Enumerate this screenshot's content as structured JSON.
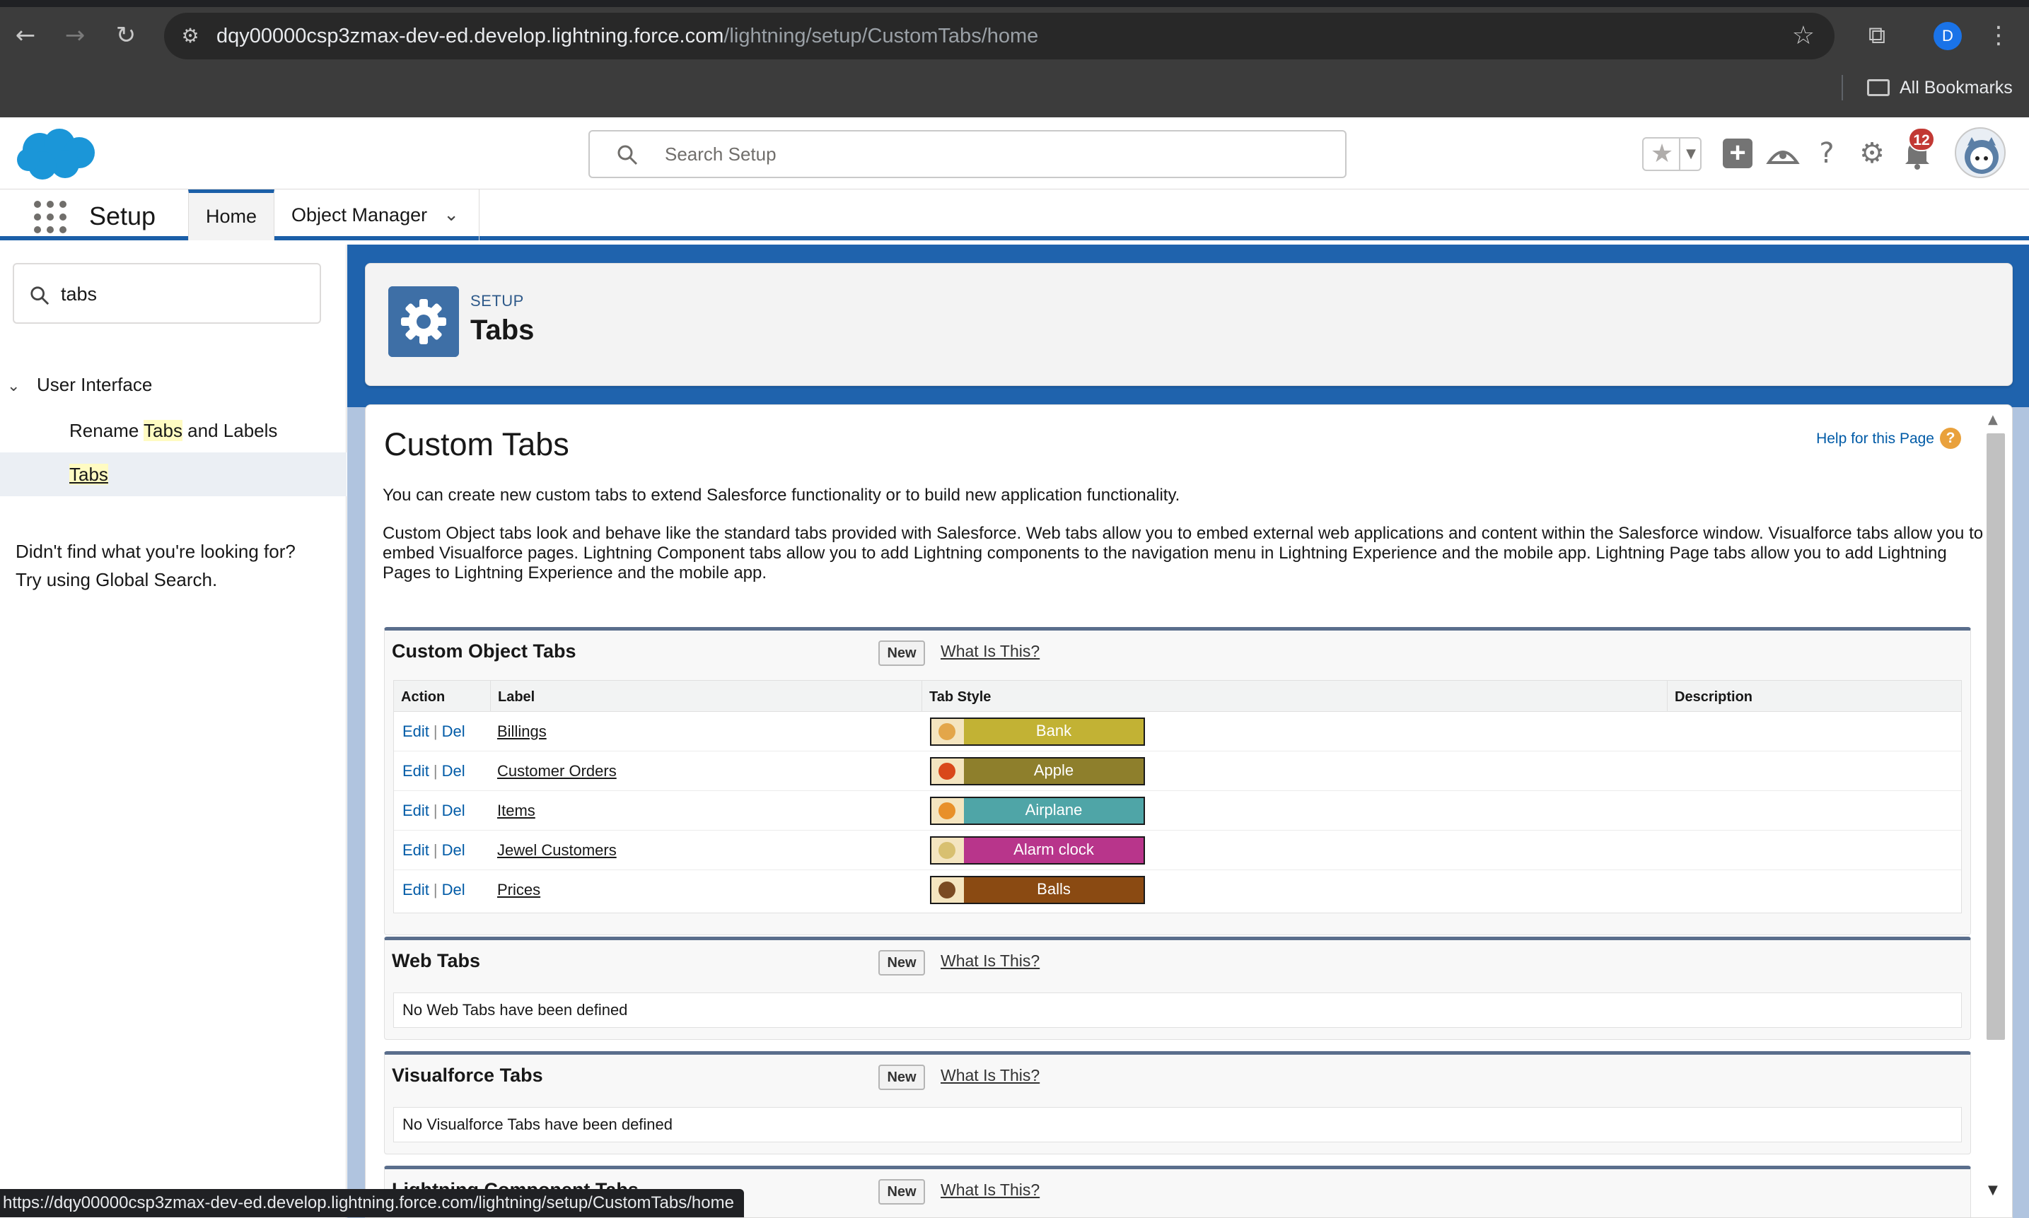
{
  "browser": {
    "url_host": "dqy00000csp3zmax-dev-ed.develop.lightning.force.com",
    "url_path": "/lightning/setup/CustomTabs/home",
    "profile_initial": "D",
    "bookmarks_label": "All Bookmarks",
    "status_url": "https://dqy00000csp3zmax-dev-ed.develop.lightning.force.com/lightning/setup/CustomTabs/home"
  },
  "header": {
    "search_placeholder": "Search Setup",
    "notification_count": "12"
  },
  "context_bar": {
    "app_name": "Setup",
    "tabs": [
      {
        "label": "Home"
      },
      {
        "label": "Object Manager"
      }
    ]
  },
  "sidebar": {
    "quick_find_value": "tabs",
    "group_label": "User Interface",
    "items": [
      {
        "pre": "Rename ",
        "match": "Tabs",
        "post": " and Labels"
      },
      {
        "pre": "",
        "match": "Tabs",
        "post": ""
      }
    ],
    "not_found_line1": "Didn't find what you're looking for?",
    "not_found_line2": "Try using Global Search."
  },
  "page_header": {
    "eyebrow": "SETUP",
    "title": "Tabs"
  },
  "content": {
    "title": "Custom Tabs",
    "help_link": "Help for this Page",
    "intro1": "You can create new custom tabs to extend Salesforce functionality or to build new application functionality.",
    "intro2": "Custom Object tabs look and behave like the standard tabs provided with Salesforce. Web tabs allow you to embed external web applications and content within the Salesforce window. Visualforce tabs allow you to embed Visualforce pages. Lightning Component tabs allow you to add Lightning components to the navigation menu in Lightning Experience and the mobile app. Lightning Page tabs allow you to add Lightning Pages to Lightning Experience and the mobile app.",
    "new_label": "New",
    "what_label": "What Is This?",
    "edit_label": "Edit",
    "del_label": "Del",
    "custom_object_tabs": {
      "title": "Custom Object Tabs",
      "columns": [
        "Action",
        "Label",
        "Tab Style",
        "Description"
      ],
      "rows": [
        {
          "label": "Billings",
          "style": "Bank",
          "color": "#c2b234",
          "icon_color": "#e3a64a"
        },
        {
          "label": "Customer Orders",
          "style": "Apple",
          "color": "#8e7f2c",
          "icon_color": "#d9481a"
        },
        {
          "label": "Items",
          "style": "Airplane",
          "color": "#4fa5a7",
          "icon_color": "#e8902a"
        },
        {
          "label": "Jewel Customers",
          "style": "Alarm clock",
          "color": "#b8358b",
          "icon_color": "#d8c070"
        },
        {
          "label": "Prices",
          "style": "Balls",
          "color": "#8a4a12",
          "icon_color": "#7a4a22"
        }
      ]
    },
    "web_tabs": {
      "title": "Web Tabs",
      "empty": "No Web Tabs have been defined"
    },
    "visualforce_tabs": {
      "title": "Visualforce Tabs",
      "empty": "No Visualforce Tabs have been defined"
    },
    "lightning_component_tabs": {
      "title": "Lightning Component Tabs"
    }
  },
  "colors": {
    "brand_blue": "#1b5fa8",
    "link_blue": "#015ba7",
    "badge_red": "#c23934"
  }
}
